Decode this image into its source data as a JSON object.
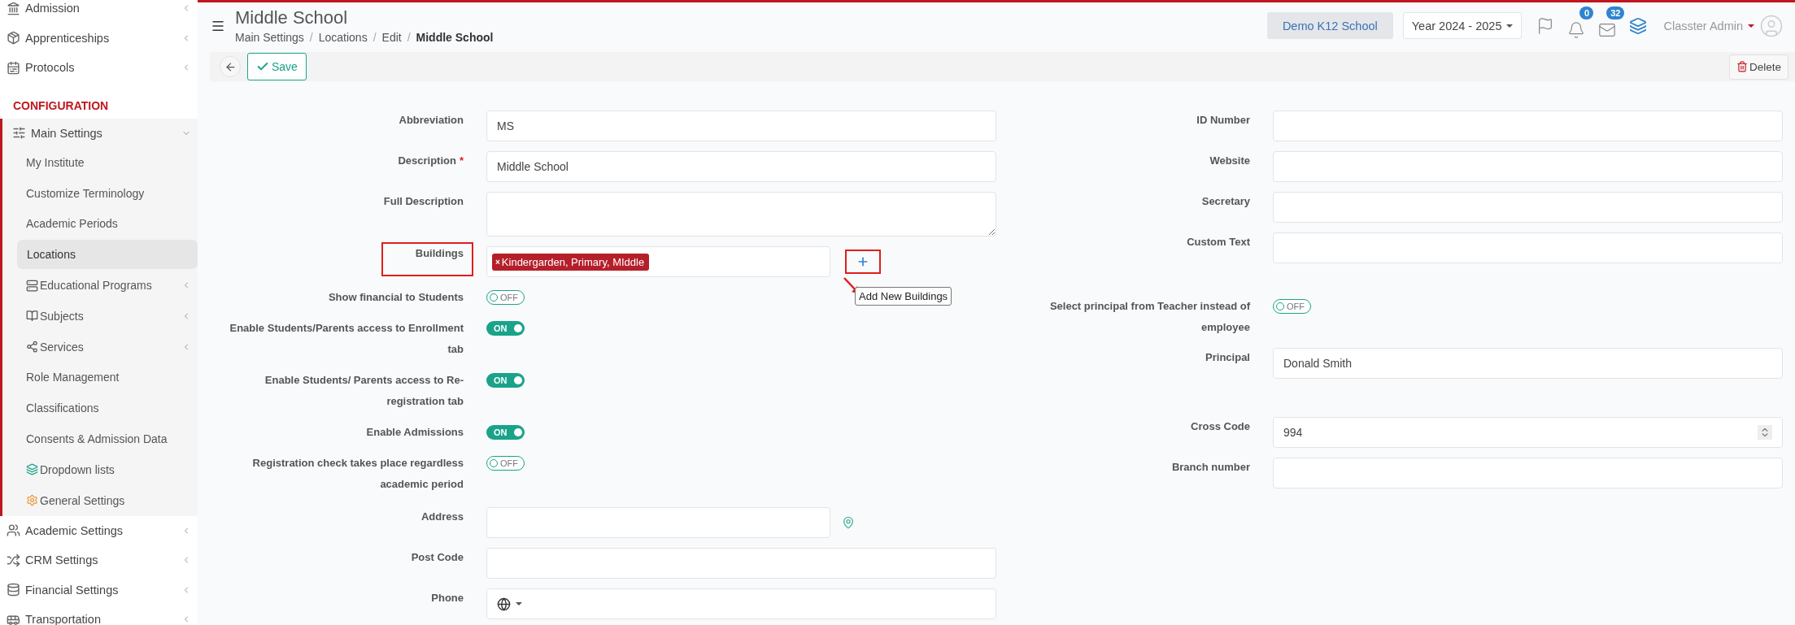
{
  "sidebar": {
    "items": [
      {
        "kind": "item",
        "label": "Admission",
        "expanded": false
      },
      {
        "kind": "item",
        "label": "Apprenticeships",
        "expanded": false
      },
      {
        "kind": "item",
        "label": "Protocols",
        "expanded": false
      },
      {
        "kind": "heading",
        "label": "CONFIGURATION"
      },
      {
        "kind": "item",
        "label": "Main Settings",
        "expanded": true,
        "children": [
          {
            "label": "My Institute",
            "selected": false
          },
          {
            "label": "Customize Terminology",
            "selected": false
          },
          {
            "label": "Academic Periods",
            "selected": false
          },
          {
            "label": "Locations",
            "selected": true
          },
          {
            "label": "Educational Programs",
            "selected": false,
            "expanded": false
          },
          {
            "label": "Subjects",
            "selected": false,
            "expanded": false
          },
          {
            "label": "Services",
            "selected": false,
            "expanded": false
          },
          {
            "label": "Role Management",
            "selected": false
          },
          {
            "label": "Classifications",
            "selected": false
          },
          {
            "label": "Consents & Admission Data",
            "selected": false
          },
          {
            "label": "Dropdown lists",
            "selected": false
          },
          {
            "label": "General Settings",
            "selected": false
          }
        ]
      },
      {
        "kind": "item",
        "label": "Academic Settings",
        "expanded": false
      },
      {
        "kind": "item",
        "label": "CRM Settings",
        "expanded": false
      },
      {
        "kind": "item",
        "label": "Financial Settings",
        "expanded": false
      },
      {
        "kind": "item",
        "label": "Transportation",
        "expanded": false
      }
    ]
  },
  "page": {
    "title": "Middle School",
    "separator": "/",
    "breadcrumb": [
      {
        "label": "Main Settings",
        "current": false
      },
      {
        "label": "Locations",
        "current": false
      },
      {
        "label": "Edit",
        "current": false
      },
      {
        "label": "Middle School",
        "current": true
      }
    ]
  },
  "topbar": {
    "school": "Demo K12 School",
    "year": "Year 2024 - 2025",
    "notifications": "0",
    "messages": "32",
    "user": "Classter Admin"
  },
  "toolbar": {
    "save": "Save",
    "delete": "Delete"
  },
  "form": {
    "required_mark": "*",
    "left": [
      {
        "kind": "text",
        "label": "Abbreviation",
        "required": false,
        "value": "MS"
      },
      {
        "kind": "text",
        "label": "Description",
        "required": true,
        "value": "Middle School"
      },
      {
        "kind": "textarea",
        "label": "Full Description",
        "required": false
      },
      {
        "kind": "tags",
        "label": "Buildings",
        "required": false,
        "highlighted": true,
        "tags": [
          "Kindergarden, Primary, MIddle"
        ],
        "remove_symbol": "×",
        "tooltip": "Add New Buildings"
      },
      {
        "kind": "toggle",
        "label": "Show financial to Students",
        "required": false,
        "on": false,
        "text": "OFF"
      },
      {
        "kind": "toggle",
        "label": "Enable Students/Parents access to Enrollment tab",
        "required": false,
        "on": true,
        "text": "ON"
      },
      {
        "kind": "toggle",
        "label": "Enable Students/ Parents access to Re-registration tab",
        "required": false,
        "on": true,
        "text": "ON"
      },
      {
        "kind": "toggle",
        "label": "Enable Admissions",
        "required": false,
        "on": true,
        "text": "ON"
      },
      {
        "kind": "toggle",
        "label": "Registration check takes place regardless academic period",
        "required": false,
        "on": false,
        "text": "OFF"
      },
      {
        "kind": "address",
        "label": "Address",
        "required": false
      },
      {
        "kind": "text",
        "label": "Post Code",
        "required": false
      },
      {
        "kind": "phone",
        "label": "Phone",
        "required": false
      }
    ],
    "right": [
      {
        "kind": "text",
        "label": "ID Number",
        "required": false
      },
      {
        "kind": "text",
        "label": "Website",
        "required": false
      },
      {
        "kind": "text",
        "label": "Secretary",
        "required": false
      },
      {
        "kind": "text",
        "label": "Custom Text",
        "required": false
      },
      {
        "kind": "toggle",
        "label": "Select principal from Teacher instead of employee",
        "required": false,
        "on": false,
        "text": "OFF"
      },
      {
        "kind": "text",
        "label": "Principal",
        "required": false,
        "value": "Donald Smith"
      },
      {
        "kind": "number",
        "label": "Cross Code",
        "required": false,
        "value": "994"
      },
      {
        "kind": "text",
        "label": "Branch number",
        "required": false
      }
    ]
  }
}
